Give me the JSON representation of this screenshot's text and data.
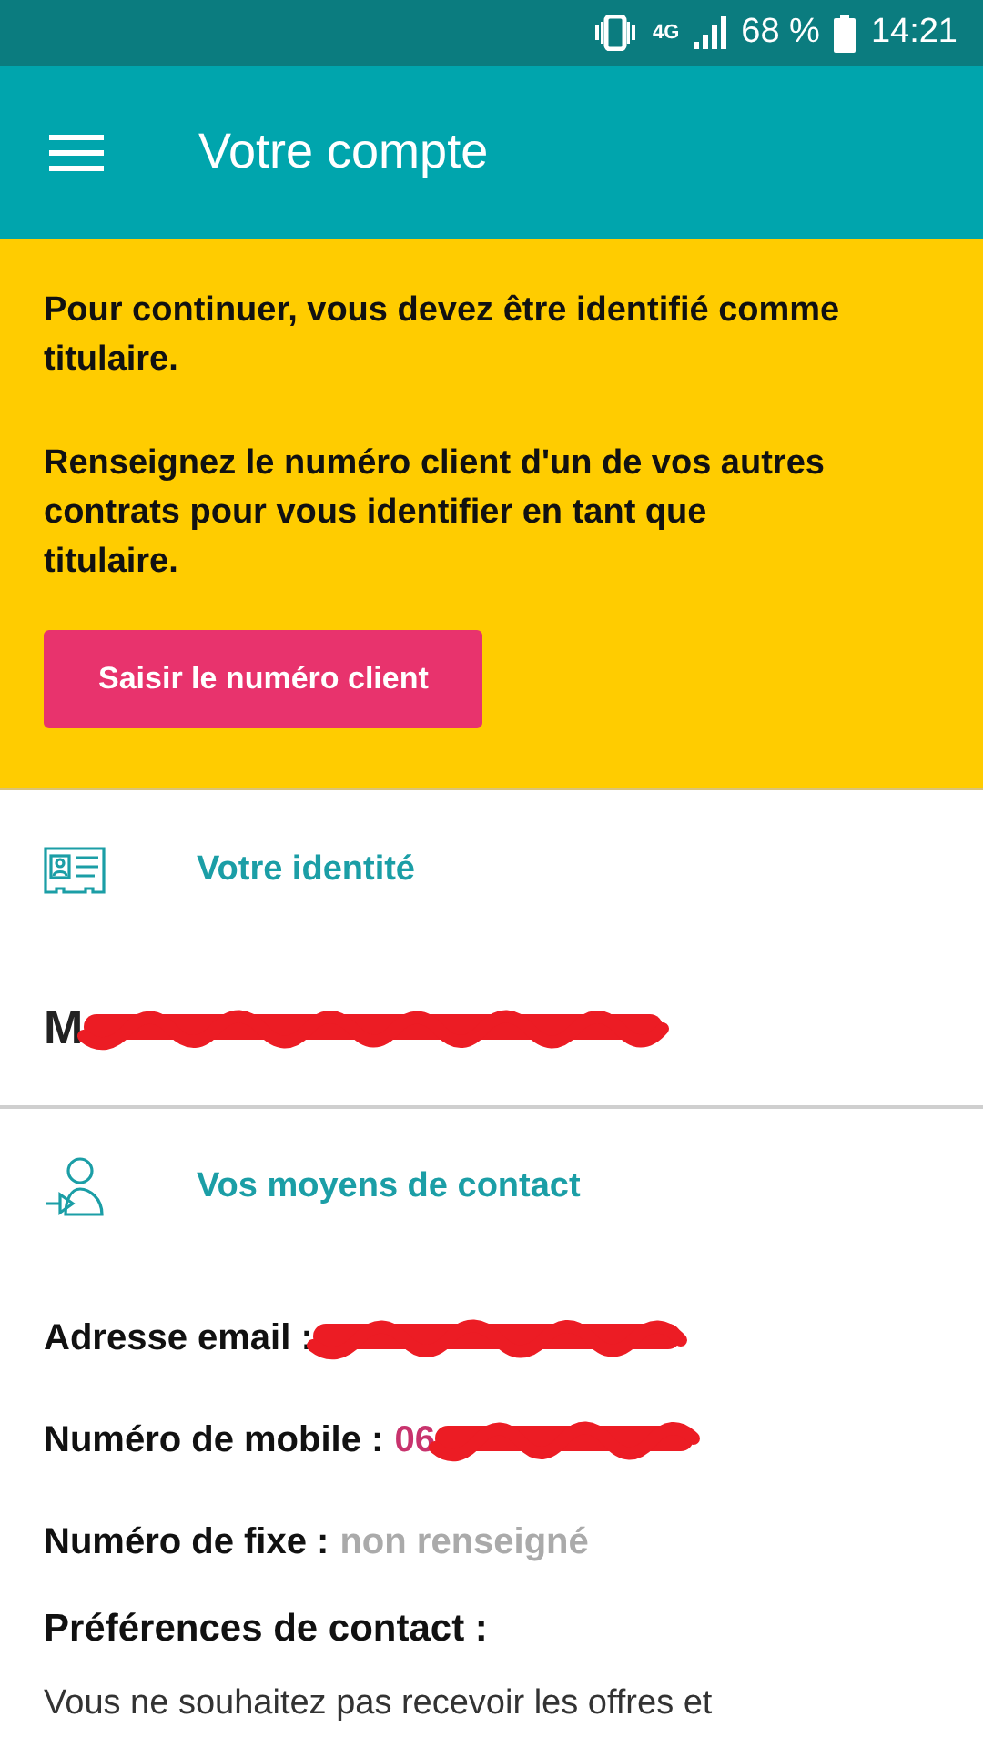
{
  "status_bar": {
    "battery": "68 %",
    "time": "14:21",
    "network": "4G"
  },
  "app_bar": {
    "title": "Votre compte"
  },
  "notice": {
    "paragraphs": [
      "Pour continuer, vous devez être identifié comme titulaire.",
      "Renseignez le numéro client d'un de vos autres contrats pour vous identifier en tant que titulaire."
    ],
    "button": "Saisir le numéro client"
  },
  "identity": {
    "title": "Votre identité",
    "name": "M",
    "redacted": true
  },
  "contact": {
    "title": "Vos moyens de contact",
    "fields": [
      {
        "label": "Adresse email :",
        "kind": "redacted"
      },
      {
        "label": "Numéro de mobile :",
        "value": "06",
        "kind": "redacted"
      },
      {
        "label": "Numéro de fixe :",
        "value": "non renseigné",
        "kind": "missing"
      }
    ],
    "preferences_title": "Préférences de contact :",
    "preferences_text": "Vous ne souhaitez pas recevoir les offres et"
  }
}
